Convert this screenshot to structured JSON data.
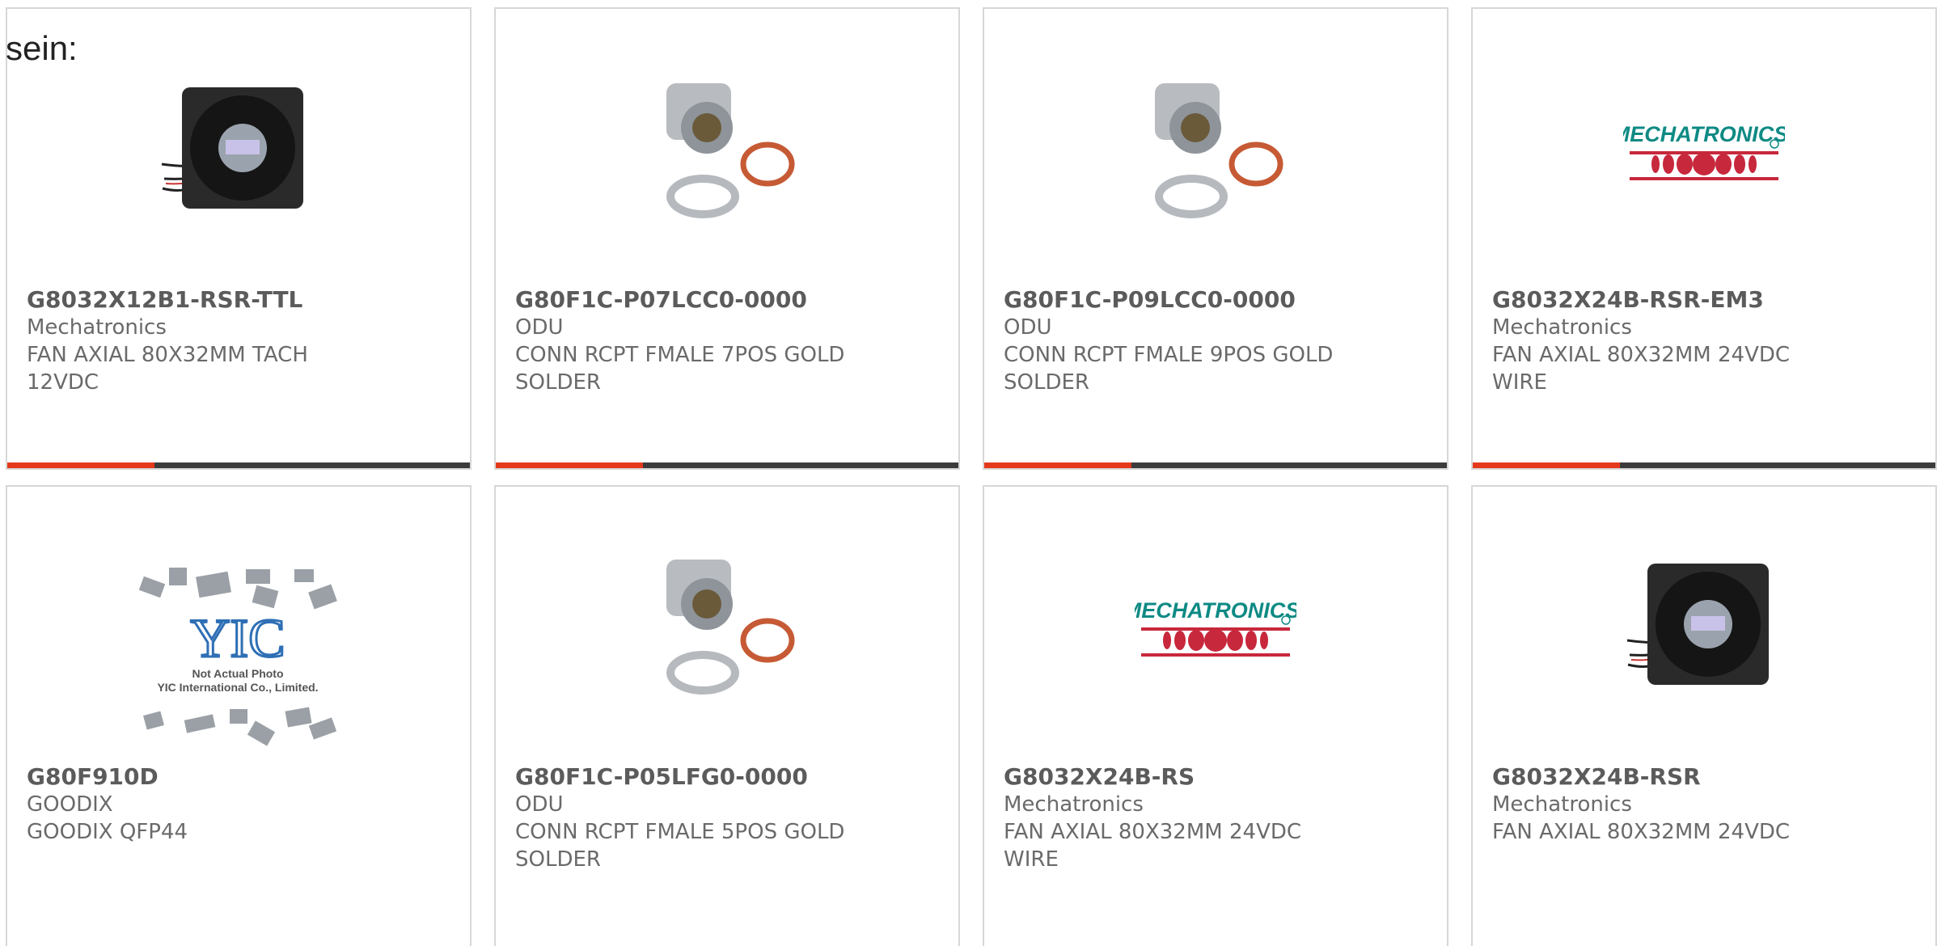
{
  "intro_text": "sein:",
  "colors": {
    "accent": "#e5391c",
    "bar": "#3b3b3b",
    "border": "#d7d7d7",
    "brand_teal": "#0e8a84",
    "brand_red": "#c8283c"
  },
  "products": [
    {
      "part": "G8032X12B1-RSR-TTL",
      "mfr": "Mechatronics",
      "desc": "FAN AXIAL 80X32MM TACH 12VDC",
      "image": "fan-icon"
    },
    {
      "part": "G80F1C-P07LCC0-0000",
      "mfr": "ODU",
      "desc": "CONN RCPT FMALE 7POS GOLD SOLDER",
      "image": "connector-icon"
    },
    {
      "part": "G80F1C-P09LCC0-0000",
      "mfr": "ODU",
      "desc": "CONN RCPT FMALE 9POS GOLD SOLDER",
      "image": "connector-icon"
    },
    {
      "part": "G8032X24B-RSR-EM3",
      "mfr": "Mechatronics",
      "desc": "FAN AXIAL 80X32MM 24VDC WIRE",
      "image": "mechatronics-logo"
    },
    {
      "part": "G80F910D",
      "mfr": "GOODIX",
      "desc": "GOODIX QFP44",
      "image": "yic-placeholder"
    },
    {
      "part": "G80F1C-P05LFG0-0000",
      "mfr": "ODU",
      "desc": "CONN RCPT FMALE 5POS GOLD SOLDER",
      "image": "connector-icon"
    },
    {
      "part": "G8032X24B-RS",
      "mfr": "Mechatronics",
      "desc": "FAN AXIAL 80X32MM 24VDC WIRE",
      "image": "mechatronics-logo"
    },
    {
      "part": "G8032X24B-RSR",
      "mfr": "Mechatronics",
      "desc": "FAN AXIAL 80X32MM 24VDC",
      "image": "fan-icon"
    }
  ],
  "logo_text": {
    "mechatronics": "MECHATRONICS",
    "yic_line1": "Not Actual Photo",
    "yic_line2": "YIC International Co., Limited."
  }
}
